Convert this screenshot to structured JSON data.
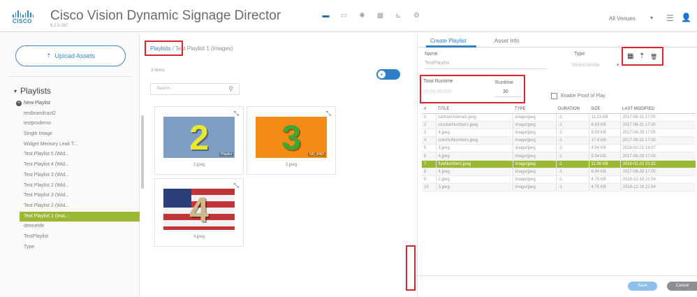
{
  "app": {
    "title": "Cisco Vision Dynamic Signage Director",
    "version": "6.2.0-267",
    "logo_text": "CISCO"
  },
  "topnav": {
    "items": [
      {
        "name": "folder-icon",
        "glyph": "▬",
        "active": true
      },
      {
        "name": "display-icon",
        "glyph": "▭"
      },
      {
        "name": "gear-icon",
        "glyph": "✺"
      },
      {
        "name": "grid-icon",
        "glyph": "▦"
      },
      {
        "name": "chart-icon",
        "glyph": "⊾"
      },
      {
        "name": "settings-icon",
        "glyph": "⚙"
      }
    ],
    "venues_label": "All Venues",
    "caret": "▾",
    "menu_glyph": "☰",
    "user_glyph": "👤"
  },
  "sidebar": {
    "upload_label": "Upload Assets",
    "upload_icon": "⇡",
    "playlists_header": "Playlists",
    "header_caret": "▾",
    "new_playlist_label": "New Playlist",
    "items": [
      "testbrandcast2",
      "testprodemo",
      "Single Image",
      "Widget Memory Leak T...",
      "Test Playlist 5 (Wid...",
      "Test Playlist 4 (Wid...",
      "Test Playlist 3 (Wid...",
      "Test Playlist 2 (Wid...",
      "Test Playlist 3 (Wid...",
      "Test Playlist 2 (Wid...",
      "Test Playlist 1 (Ima...",
      "dennehfe",
      "TestPlaylist",
      "Type"
    ],
    "selected_index": 10
  },
  "assets": {
    "breadcrumb_root": "Playlists",
    "breadcrumb_sep": "/",
    "breadcrumb_current": "Test Playlist 1 (Images)",
    "item_count": "3 Items",
    "toggle_glyph": "▪",
    "search_placeholder": "Search",
    "search_glyph": "⚲",
    "corner_glyph": "⤡",
    "tiles": [
      {
        "caption": "2.jpeg",
        "digit": "2",
        "bg": "#7f9ec4",
        "fg": "#e7ea2a",
        "overlay": "Playlist"
      },
      {
        "caption": "3.jpeg",
        "digit": "3",
        "bg": "#f28c16",
        "fg": "#3fa736",
        "overlay": "NO_END"
      },
      {
        "caption": "4.jpeg",
        "digit": "4",
        "bg": "#c23438",
        "fg": "#cfb889",
        "overlay": ""
      }
    ]
  },
  "editor": {
    "tabs": [
      "Create Playlist",
      "Asset Info"
    ],
    "name_label": "Name",
    "name_value": "TestPlaylist",
    "type_label": "Type",
    "type_value": "Mixed Media",
    "type_caret": "▾",
    "toolbar": {
      "grid_glyph": "▦",
      "upload_glyph": "⇡",
      "delete_glyph": "🗑"
    },
    "total_runtime_label": "Total Runtime",
    "total_runtime_value": "00:00:00:000",
    "runtime_label": "Runtime",
    "runtime_value": "30",
    "enable_pop_label": "Enable Proof of Play",
    "table": {
      "columns": [
        "#",
        "TITLE",
        "TYPE",
        "DURATION",
        "SIZE",
        "LAST MODIFIED"
      ],
      "rows": [
        [
          "1",
          "cartoonAnimals.jpeg",
          "image/jpeg",
          "-1",
          "11.23 KB",
          "2017-08-31 17:00"
        ],
        [
          "2",
          "circularNumbers.jpeg",
          "image/jpeg",
          "-1",
          "8.63 KB",
          "2017-08-31 17:00"
        ],
        [
          "3",
          "4.jpeg",
          "image/jpeg",
          "-1",
          "8.59 KB",
          "2017-08-28 17:00"
        ],
        [
          "4",
          "colorfulNumbers.jpeg",
          "image/jpeg",
          "-1",
          "17.8 KB",
          "2017-08-31 17:00"
        ],
        [
          "5",
          "3.jpeg",
          "image/jpeg",
          "-1",
          "4.94 KB",
          "2018-02-21 14:07"
        ],
        [
          "6",
          "4.jpeg",
          "image/jpeg",
          "-1",
          "8.94 KB",
          "2017-08-28 17:00"
        ],
        [
          "7",
          "fiveNumbers.jpeg",
          "image/jpeg",
          "-1",
          "11.98 KB",
          "2018-02-20 23:32"
        ],
        [
          "8",
          "4.jpeg",
          "image/jpeg",
          "-1",
          "8.94 KB",
          "2017-08-28 17:00"
        ],
        [
          "9",
          "2.jpeg",
          "image/jpeg",
          "-1",
          "4.75 KB",
          "2018-12-18 21:54"
        ],
        [
          "10",
          "3.jpeg",
          "image/jpeg",
          "-1",
          "4.75 KB",
          "2018-12-18 21:54"
        ]
      ],
      "selected_row": 6
    },
    "save_label": "Save",
    "cancel_label": "Cancel"
  },
  "colors": {
    "accent": "#2f7fc6",
    "selection": "#9bb832",
    "highlight_box": "#d8242d"
  }
}
